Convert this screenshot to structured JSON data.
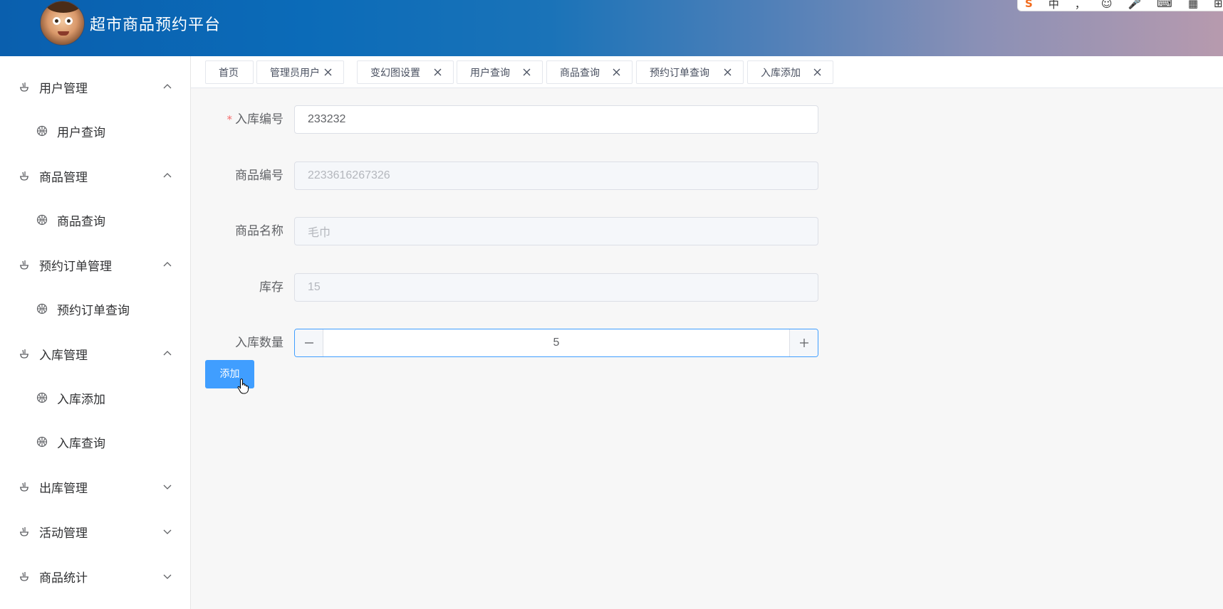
{
  "header": {
    "title": "超市商品预约平台",
    "avatar_icon": "cartoon-avatar",
    "ime_toolbar": {
      "items": [
        "S",
        "中",
        "，",
        "☺",
        "🎤",
        "⌨",
        "▦",
        "⊞"
      ]
    }
  },
  "sidebar": {
    "groups": [
      {
        "label": "用户管理",
        "expanded": true,
        "items": [
          {
            "label": "用户查询"
          }
        ]
      },
      {
        "label": "商品管理",
        "expanded": true,
        "items": [
          {
            "label": "商品查询"
          }
        ]
      },
      {
        "label": "预约订单管理",
        "expanded": true,
        "items": [
          {
            "label": "预约订单查询"
          }
        ]
      },
      {
        "label": "入库管理",
        "expanded": true,
        "items": [
          {
            "label": "入库添加"
          },
          {
            "label": "入库查询"
          }
        ]
      },
      {
        "label": "出库管理",
        "expanded": false,
        "items": []
      },
      {
        "label": "活动管理",
        "expanded": false,
        "items": []
      },
      {
        "label": "商品统计",
        "expanded": false,
        "items": []
      }
    ]
  },
  "tabs": [
    {
      "label": "首页",
      "closable": false
    },
    {
      "label": "管理员用户",
      "closable": true
    },
    {
      "label": "变幻图设置",
      "closable": true
    },
    {
      "label": "用户查询",
      "closable": true
    },
    {
      "label": "商品查询",
      "closable": true
    },
    {
      "label": "预约订单查询",
      "closable": true
    },
    {
      "label": "入库添加",
      "closable": true,
      "active": true
    }
  ],
  "form": {
    "fields": [
      {
        "label": "入库编号",
        "required": true,
        "value": "233232",
        "disabled": false
      },
      {
        "label": "商品编号",
        "required": false,
        "value": "2233616267326",
        "disabled": true
      },
      {
        "label": "商品名称",
        "required": false,
        "value": "毛巾",
        "disabled": true
      },
      {
        "label": "库存",
        "required": false,
        "value": "15",
        "disabled": true
      }
    ],
    "quantity": {
      "label": "入库数量",
      "value": "5"
    },
    "submit_label": "添加"
  },
  "colors": {
    "primary": "#409eff",
    "required": "#f56c6c",
    "header_start": "#0a5fae"
  }
}
